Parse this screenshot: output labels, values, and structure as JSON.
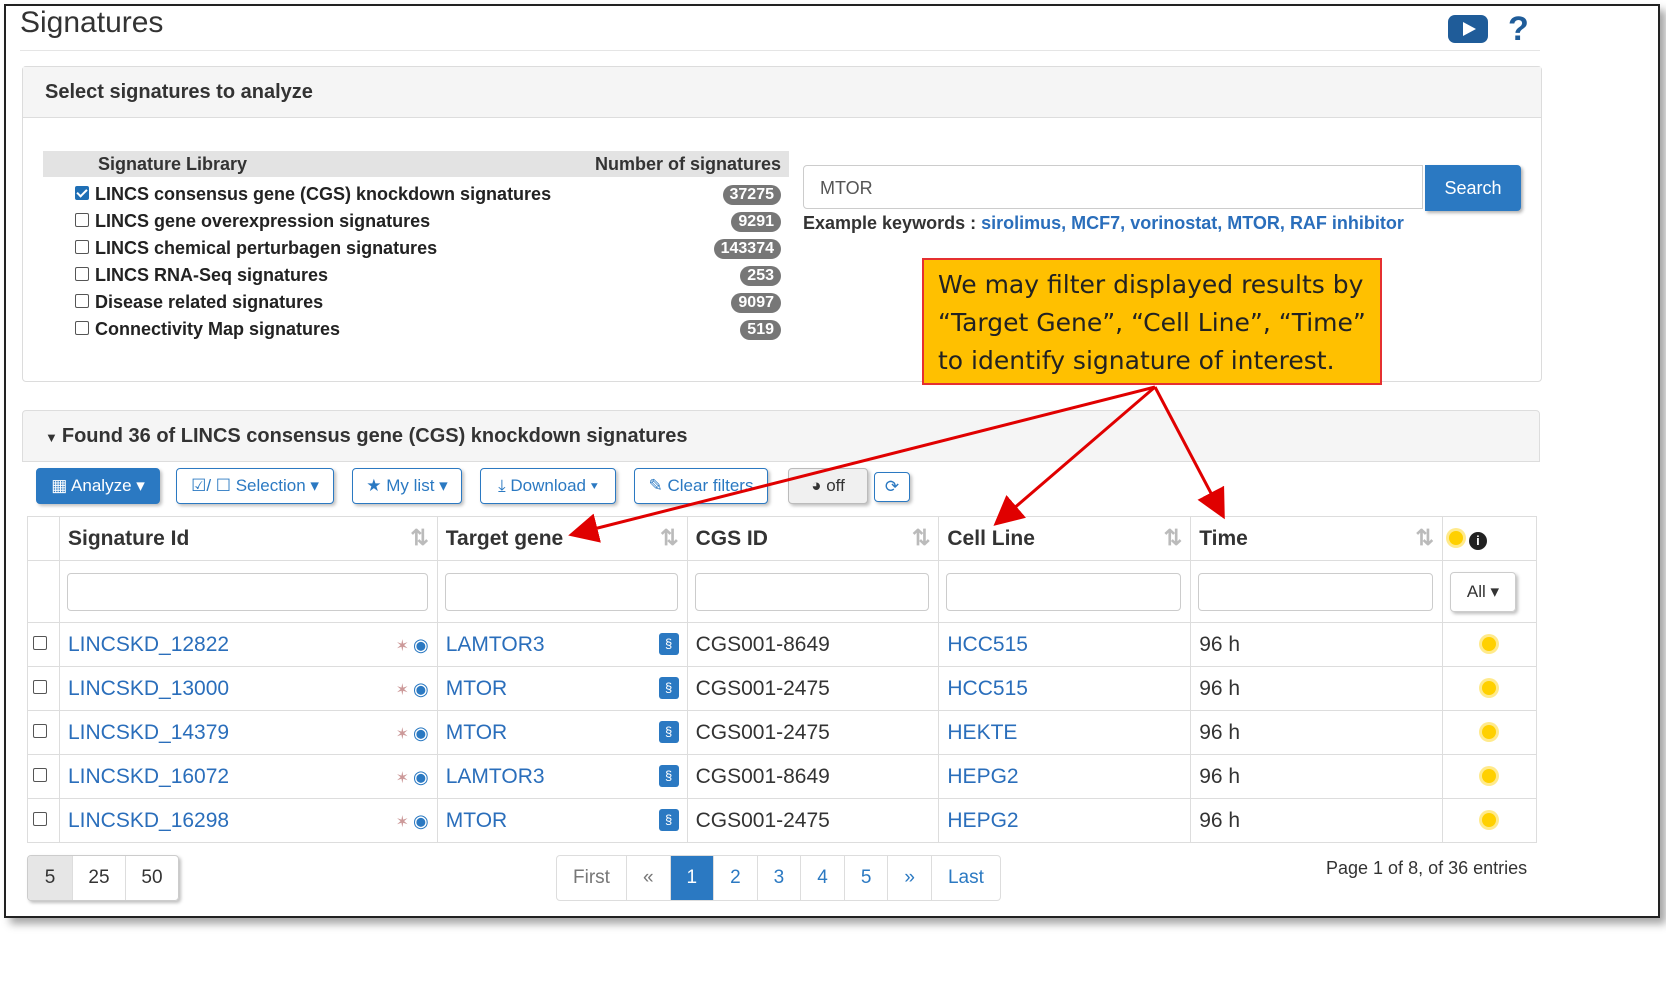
{
  "page": {
    "title": "Signatures"
  },
  "select_panel": {
    "heading": "Select signatures to analyze",
    "table_headers": {
      "library": "Signature Library",
      "count": "Number of signatures"
    },
    "libraries": [
      {
        "label": "LINCS consensus gene (CGS) knockdown signatures",
        "count": "37275",
        "checked": true
      },
      {
        "label": "LINCS gene overexpression signatures",
        "count": "9291",
        "checked": false
      },
      {
        "label": "LINCS chemical perturbagen signatures",
        "count": "143374",
        "checked": false
      },
      {
        "label": "LINCS RNA-Seq signatures",
        "count": "253",
        "checked": false
      },
      {
        "label": "Disease related signatures",
        "count": "9097",
        "checked": false
      },
      {
        "label": "Connectivity Map signatures",
        "count": "519",
        "checked": false
      }
    ],
    "search": {
      "value": "MTOR",
      "button": "Search"
    },
    "examples": {
      "prefix": "Example keywords :",
      "keywords": [
        "sirolimus",
        "MCF7",
        "vorinostat",
        "MTOR",
        "RAF inhibitor"
      ]
    }
  },
  "callout": {
    "lines": [
      "We may filter displayed results by",
      "“Target Gene”, “Cell Line”, “Time”",
      "to identify signature of interest."
    ]
  },
  "results_panel": {
    "heading": "Found 36 of LINCS consensus gene (CGS) knockdown signatures",
    "toolbar": {
      "analyze": "Analyze",
      "selection": "/ ☐ Selection",
      "mylist": "My list",
      "download": "Download",
      "clear": "Clear filters",
      "toggle": "off"
    },
    "columns": [
      "Signature Id",
      "Target gene",
      "CGS ID",
      "Cell Line",
      "Time"
    ],
    "filter_all": "All",
    "rows": [
      {
        "id": "LINCSKD_12822",
        "gene": "LAMTOR3",
        "cgs": "CGS001-8649",
        "cell": "HCC515",
        "time": "96 h"
      },
      {
        "id": "LINCSKD_13000",
        "gene": "MTOR",
        "cgs": "CGS001-2475",
        "cell": "HCC515",
        "time": "96 h"
      },
      {
        "id": "LINCSKD_14379",
        "gene": "MTOR",
        "cgs": "CGS001-2475",
        "cell": "HEKTE",
        "time": "96 h"
      },
      {
        "id": "LINCSKD_16072",
        "gene": "LAMTOR3",
        "cgs": "CGS001-8649",
        "cell": "HEPG2",
        "time": "96 h"
      },
      {
        "id": "LINCSKD_16298",
        "gene": "MTOR",
        "cgs": "CGS001-2475",
        "cell": "HEPG2",
        "time": "96 h"
      }
    ],
    "page_sizes": [
      "5",
      "25",
      "50"
    ],
    "pagination": [
      "First",
      "«",
      "1",
      "2",
      "3",
      "4",
      "5",
      "»",
      "Last"
    ],
    "page_info": "Page 1 of 8, of 36 entries"
  }
}
